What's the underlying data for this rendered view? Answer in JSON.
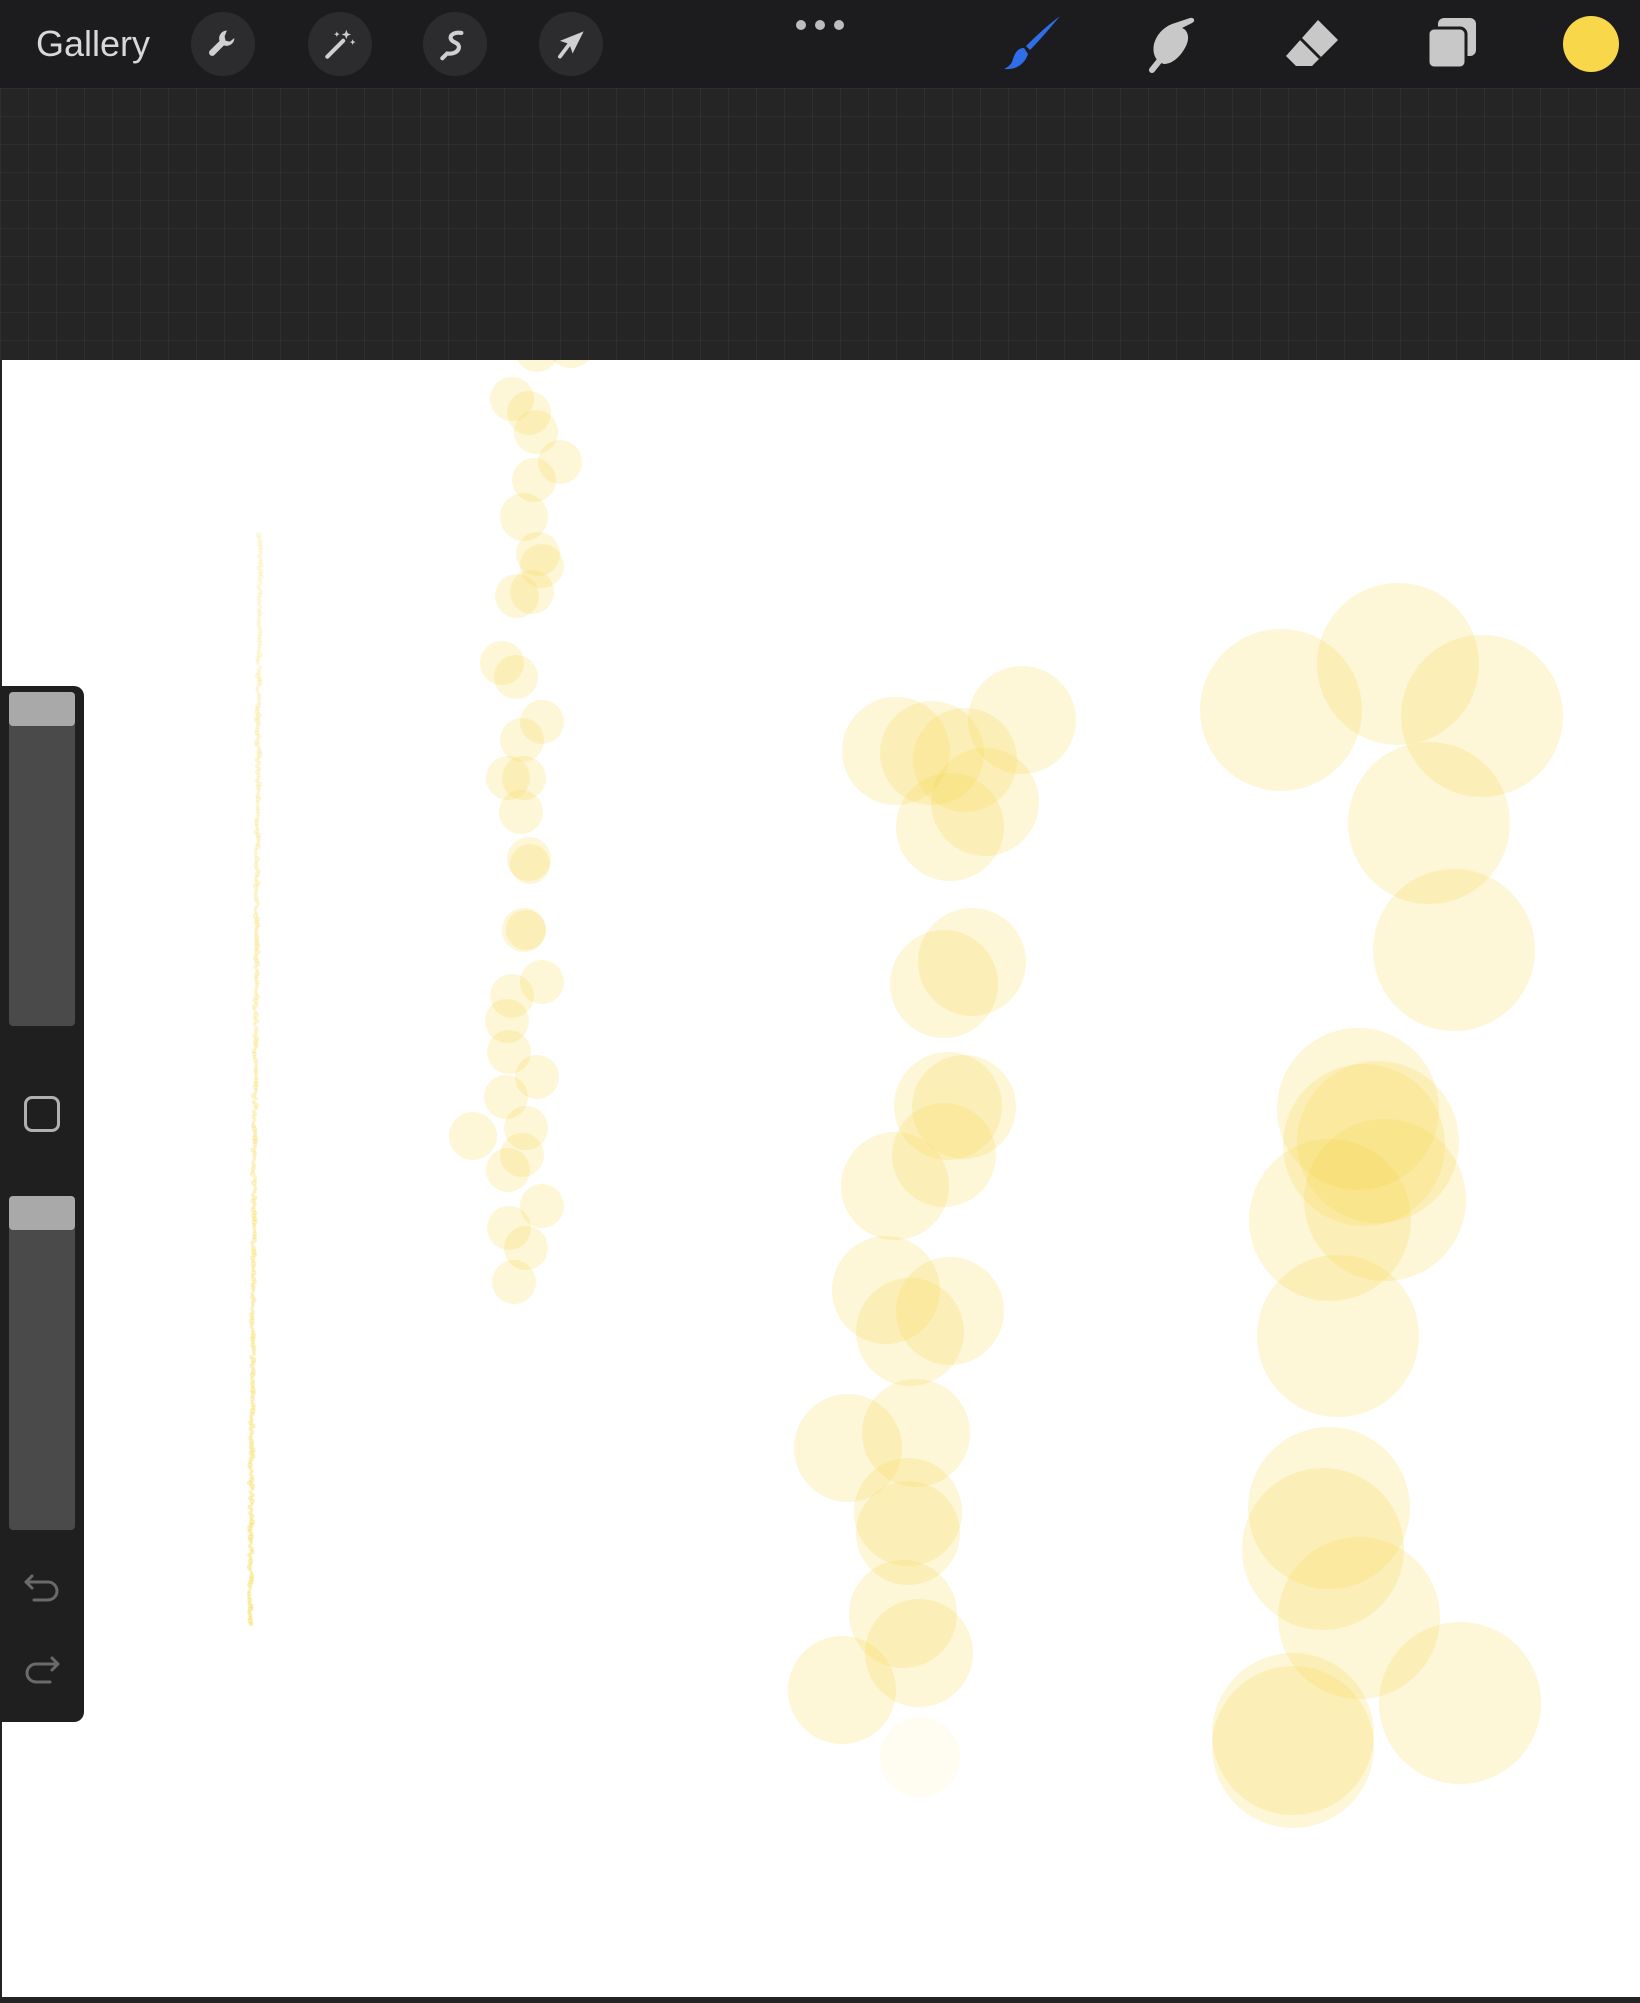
{
  "topbar": {
    "gallery_label": "Gallery",
    "actions_icon": "wrench-icon",
    "adjustments_icon": "magic-wand-icon",
    "selection_icon": "selection-s-icon",
    "transform_icon": "arrow-cursor-icon",
    "more_icon": "ellipsis-icon",
    "brush_icon": "paintbrush-icon",
    "smudge_icon": "smudge-finger-icon",
    "eraser_icon": "eraser-icon",
    "layers_icon": "layers-icon",
    "brush_active_color": "#2f6ee8",
    "current_color": "#f8d84a"
  },
  "sidebar": {
    "size_slider_value": 1.0,
    "opacity_slider_value": 1.0,
    "modify_icon": "square-icon",
    "undo_icon": "undo-icon",
    "redo_icon": "redo-icon"
  },
  "canvas": {
    "background": "#ffffff",
    "stroke_color": "#f8d84a"
  }
}
